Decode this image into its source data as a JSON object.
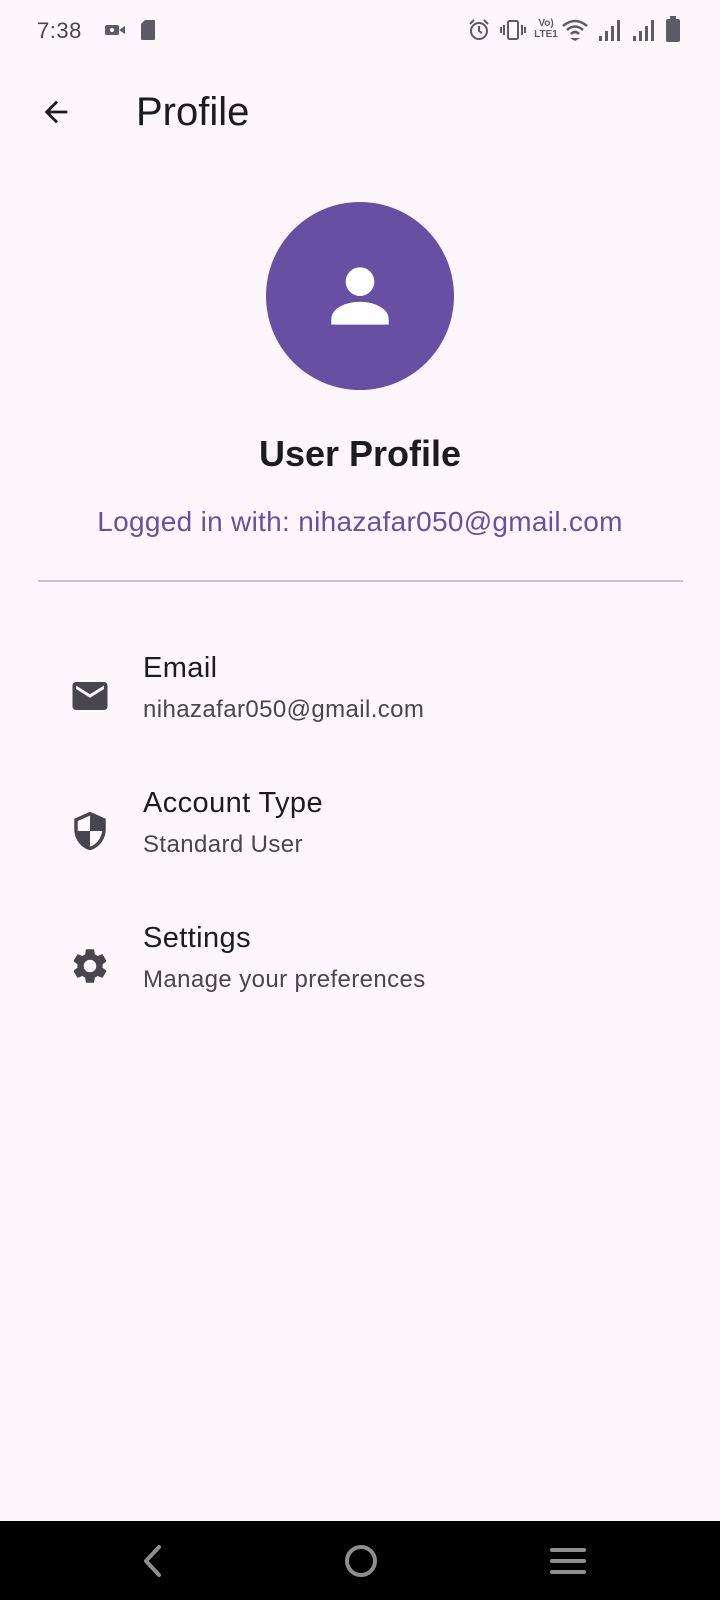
{
  "status_bar": {
    "time": "7:38",
    "left_icons": [
      "video-camera-icon",
      "sd-card-icon"
    ],
    "right_icons": [
      "alarm-icon",
      "vibrate-icon",
      "volte-icon",
      "wifi-icon",
      "signal-icon",
      "signal-icon",
      "battery-icon"
    ],
    "volte_line1": "Vo)",
    "volte_line2": "LTE1"
  },
  "app_bar": {
    "title": "Profile",
    "back_icon": "arrow-back-icon"
  },
  "profile": {
    "avatar_icon": "person-icon",
    "heading": "User Profile",
    "logged_in_line": "Logged in with: nihazafar050@gmail.com"
  },
  "items": [
    {
      "icon": "mail-icon",
      "title": "Email",
      "subtitle": "nihazafar050@gmail.com"
    },
    {
      "icon": "shield-icon",
      "title": "Account Type",
      "subtitle": "Standard User"
    },
    {
      "icon": "gear-icon",
      "title": "Settings",
      "subtitle": "Manage your preferences"
    }
  ],
  "nav_bar": {
    "icons": [
      "nav-back-icon",
      "nav-home-icon",
      "nav-recents-icon"
    ]
  },
  "colors": {
    "accent": "#6750a4",
    "background": "#fdf7fd",
    "divider": "#cac4d0",
    "icon": "#49454f"
  }
}
